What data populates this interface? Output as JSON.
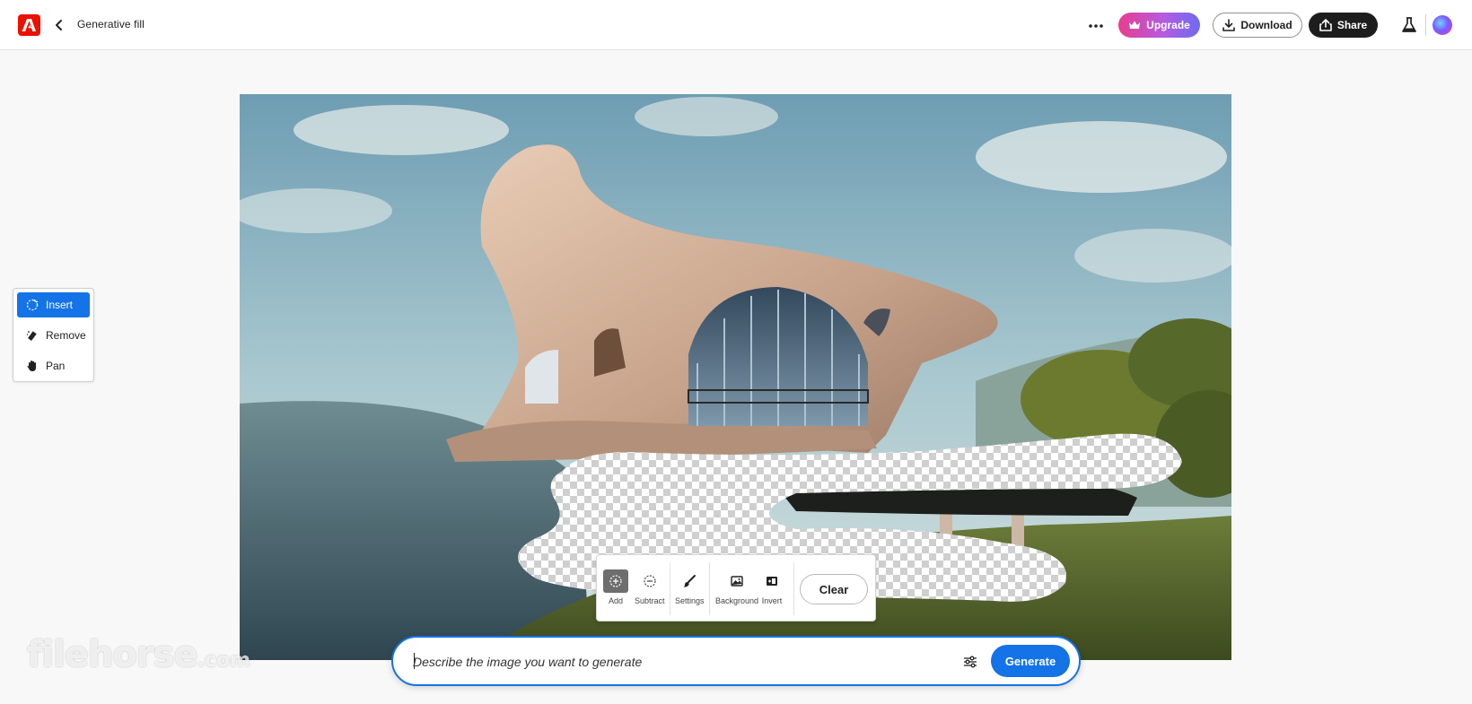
{
  "header": {
    "title": "Generative fill",
    "upgrade_label": "Upgrade",
    "download_label": "Download",
    "share_label": "Share"
  },
  "tools": {
    "items": [
      {
        "label": "Insert",
        "icon": "insert-icon",
        "active": true
      },
      {
        "label": "Remove",
        "icon": "eraser-icon",
        "active": false
      },
      {
        "label": "Pan",
        "icon": "hand-icon",
        "active": false
      }
    ]
  },
  "brush_toolbar": {
    "add_label": "Add",
    "subtract_label": "Subtract",
    "settings_label": "Settings",
    "background_label": "Background",
    "invert_label": "Invert",
    "clear_label": "Clear"
  },
  "prompt": {
    "placeholder": "Describe the image you want to generate",
    "generate_label": "Generate"
  },
  "watermark": {
    "brand": "filehorse",
    "suffix": ".com"
  },
  "colors": {
    "accent": "#1473e6",
    "adobe_red": "#eb1000",
    "share_bg": "#1d1d1d"
  }
}
